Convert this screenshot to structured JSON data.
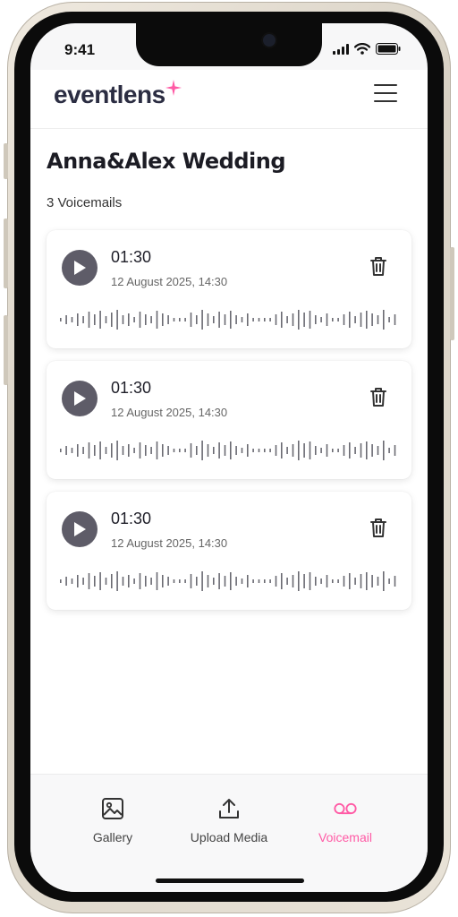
{
  "status_bar": {
    "time": "9:41"
  },
  "header": {
    "logo_text": "eventlens",
    "menu_icon": "hamburger-icon",
    "brand_accent": "#ff5aa5"
  },
  "page": {
    "title": "Anna&Alex Wedding",
    "count_label": "3 Voicemails"
  },
  "voicemails": [
    {
      "duration": "01:30",
      "date": "12 August 2025, 14:30"
    },
    {
      "duration": "01:30",
      "date": "12 August 2025, 14:30"
    },
    {
      "duration": "01:30",
      "date": "12 August 2025, 14:30"
    }
  ],
  "fab": {
    "icon": "phone-message-icon",
    "color": "#ff5aa5"
  },
  "tabs": [
    {
      "label": "Gallery",
      "icon": "image-icon",
      "active": false
    },
    {
      "label": "Upload Media",
      "icon": "upload-icon",
      "active": false
    },
    {
      "label": "Voicemail",
      "icon": "voicemail-icon",
      "active": true
    }
  ]
}
